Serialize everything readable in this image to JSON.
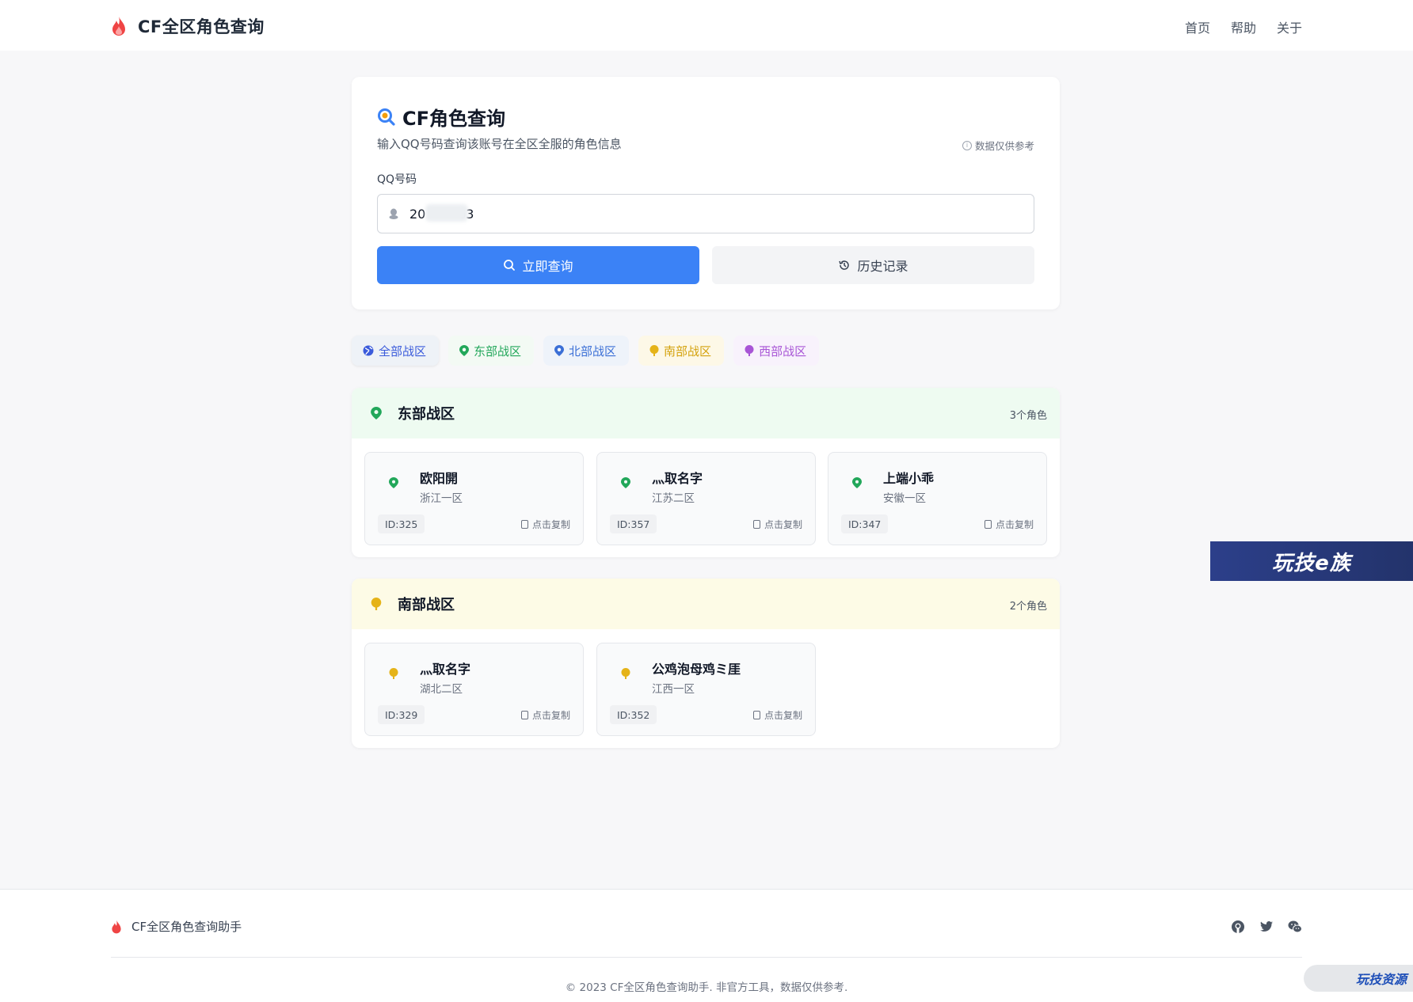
{
  "header": {
    "title": "CF全区角色查询",
    "nav": [
      "首页",
      "帮助",
      "关于"
    ]
  },
  "search": {
    "title": "CF角色查询",
    "subtitle": "输入QQ号码查询该账号在全区全服的角色信息",
    "note": "数据仅供参考",
    "field_label": "QQ号码",
    "qq_value": "20        63",
    "query_button": "立即查询",
    "history_button": "历史记录"
  },
  "tabs": [
    {
      "label": "全部战区",
      "color": "#3b5bdb"
    },
    {
      "label": "东部战区",
      "color": "#22a75a"
    },
    {
      "label": "北部战区",
      "color": "#3b6fd6"
    },
    {
      "label": "南部战区",
      "color": "#d4a20d"
    },
    {
      "label": "西部战区",
      "color": "#a855d6"
    }
  ],
  "sections": {
    "east": {
      "title": "东部战区",
      "count": "3个角色",
      "color": "#22a75a",
      "roles": [
        {
          "name": "欧阳開",
          "zone": "浙江一区",
          "id": "ID:325",
          "copy": "点击复制"
        },
        {
          "name": "灬取名字",
          "zone": "江苏二区",
          "id": "ID:357",
          "copy": "点击复制"
        },
        {
          "name": "上端小乖",
          "zone": "安徽一区",
          "id": "ID:347",
          "copy": "点击复制"
        }
      ]
    },
    "south": {
      "title": "南部战区",
      "count": "2个角色",
      "color": "#d4a20d",
      "roles": [
        {
          "name": "灬取名字",
          "zone": "湖北二区",
          "id": "ID:329",
          "copy": "点击复制"
        },
        {
          "name": "公鸡泡母鸡ミ厓",
          "zone": "江西一区",
          "id": "ID:352",
          "copy": "点击复制"
        }
      ]
    }
  },
  "ad": {
    "text": "玩技e族"
  },
  "footer": {
    "brand": "CF全区角色查询助手",
    "copyright": "© 2023 CF全区角色查询助手. 非官方工具，数据仅供参考.",
    "icons": [
      "github-icon",
      "twitter-icon",
      "wechat-icon"
    ]
  },
  "watermark": {
    "text": "玩技资源"
  }
}
